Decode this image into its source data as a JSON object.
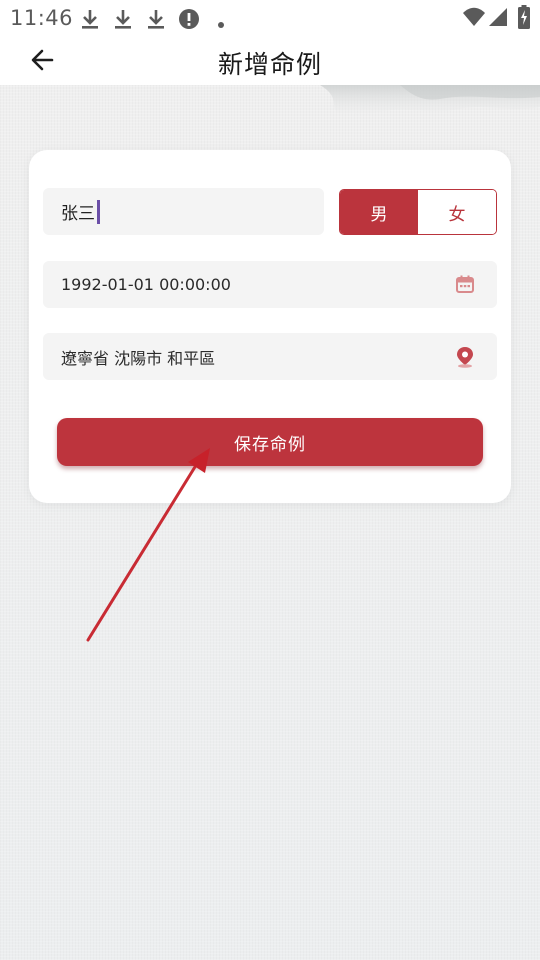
{
  "status_bar": {
    "time": "11:46",
    "icons": [
      "download-icon",
      "download-icon",
      "download-icon",
      "alert-icon",
      "dot-icon",
      "wifi-icon",
      "signal-icon",
      "battery-charging-icon"
    ]
  },
  "app_bar": {
    "title": "新增命例",
    "back_icon": "arrow-left-icon"
  },
  "form": {
    "name_value": "张三",
    "gender": {
      "male_label": "男",
      "female_label": "女",
      "selected": "男"
    },
    "birth_datetime": "1992-01-01 00:00:00",
    "birthplace": "遼寧省 沈陽市 和平區",
    "date_icon": "calendar-icon",
    "location_icon": "location-pin-icon",
    "save_label": "保存命例"
  },
  "colors": {
    "accent": "#bd343d",
    "background": "#ececec",
    "card": "#ffffff",
    "field": "#f4f4f4"
  }
}
